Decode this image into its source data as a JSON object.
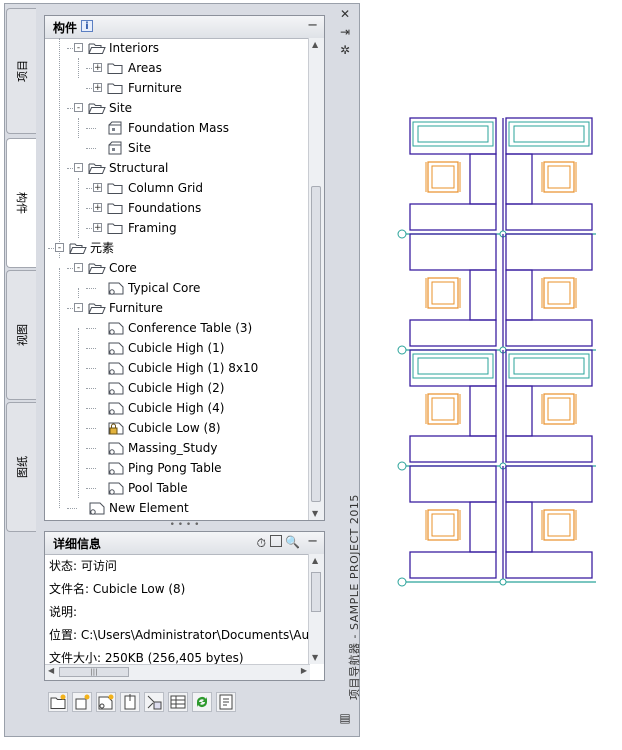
{
  "palette": {
    "vertical_title": "项目导航器 - SAMPLE PROJECT 2015",
    "side_tabs": [
      "项目",
      "构件",
      "视图",
      "图纸"
    ],
    "active_tab": "构件",
    "close_icon": "close-icon",
    "autohide_icon": "autohide-icon",
    "properties_icon": "properties-icon"
  },
  "components": {
    "title": "构件",
    "info_badge": "i",
    "collapse": "−",
    "tree": [
      {
        "label": "Interiors"
      },
      {
        "label": "Areas"
      },
      {
        "label": "Furniture"
      },
      {
        "label": "Site"
      },
      {
        "label": "Foundation Mass"
      },
      {
        "label": "Site"
      },
      {
        "label": "Structural"
      },
      {
        "label": "Column Grid"
      },
      {
        "label": "Foundations"
      },
      {
        "label": "Framing"
      },
      {
        "label": "元素"
      },
      {
        "label": "Core"
      },
      {
        "label": "Typical Core"
      },
      {
        "label": "Furniture"
      },
      {
        "label": "Conference Table (3)"
      },
      {
        "label": "Cubicle High (1)"
      },
      {
        "label": "Cubicle High (1) 8x10"
      },
      {
        "label": "Cubicle High (2)"
      },
      {
        "label": "Cubicle High (4)"
      },
      {
        "label": "Cubicle Low (8)",
        "locked": true
      },
      {
        "label": "Massing_Study"
      },
      {
        "label": "Ping Pong Table"
      },
      {
        "label": "Pool Table"
      },
      {
        "label": "New Element"
      }
    ]
  },
  "details": {
    "title": "详细信息",
    "collapse": "−",
    "rows": [
      {
        "label": "状态: 可访问"
      },
      {
        "label": "文件名: Cubicle Low (8)"
      },
      {
        "label": "说明:"
      },
      {
        "label": "位置: C:\\Users\\Administrator\\Documents\\Aut"
      },
      {
        "label": "文件大小: 250KB (256,405 bytes)"
      }
    ]
  },
  "toolbar": {
    "buttons": [
      "new-category-icon",
      "new-construct-icon",
      "new-element-icon",
      "attach-icon",
      "repath-icon",
      "table-icon",
      "refresh-icon",
      "graph-icon"
    ]
  },
  "colors": {
    "drawing_outline": "#3b1fa0",
    "furniture": "#e8902a",
    "fixtures": "#2aa39a"
  }
}
